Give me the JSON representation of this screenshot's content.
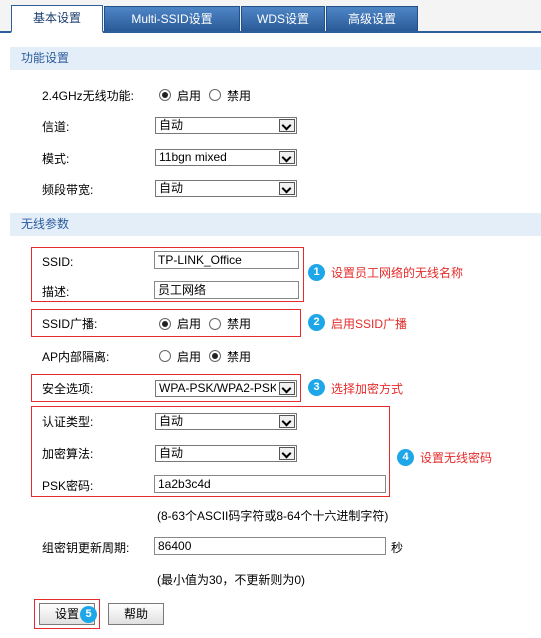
{
  "tabs": [
    "基本设置",
    "Multi-SSID设置",
    "WDS设置",
    "高级设置"
  ],
  "function_section": {
    "title": "功能设置",
    "wireless_label": "2.4GHz无线功能:",
    "enable": "启用",
    "disable": "禁用",
    "channel_label": "信道:",
    "channel_value": "自动",
    "mode_label": "模式:",
    "mode_value": "11bgn mixed",
    "bandwidth_label": "频段带宽:",
    "bandwidth_value": "自动"
  },
  "wireless_section": {
    "title": "无线参数",
    "ssid_label": "SSID:",
    "ssid_value": "TP-LINK_Office",
    "desc_label": "描述:",
    "desc_value": "员工网络",
    "broadcast_label": "SSID广播:",
    "isolation_label": "AP内部隔离:",
    "enable": "启用",
    "disable": "禁用",
    "security_label": "安全选项:",
    "security_value": "WPA-PSK/WPA2-PSK",
    "auth_label": "认证类型:",
    "auth_value": "自动",
    "encrypt_label": "加密算法:",
    "encrypt_value": "自动",
    "psk_label": "PSK密码:",
    "psk_value": "1a2b3c4d",
    "psk_hint": "(8-63个ASCII码字符或8-64个十六进制字符)",
    "renew_label": "组密钥更新周期:",
    "renew_value": "86400",
    "renew_unit": "秒",
    "renew_hint": "(最小值为30，不更新则为0)"
  },
  "annotations": [
    {
      "num": "1",
      "text": "设置员工网络的无线名称"
    },
    {
      "num": "2",
      "text": "启用SSID广播"
    },
    {
      "num": "3",
      "text": "选择加密方式"
    },
    {
      "num": "4",
      "text": "设置无线密码"
    },
    {
      "num": "5",
      "text": ""
    }
  ],
  "buttons": {
    "save": "设置",
    "help": "帮助"
  },
  "colors": {
    "tab_blue": "#2d5f9b",
    "section_bg": "#e4eef9",
    "highlight_red": "#e52b2b",
    "badge_blue": "#1ea7e8"
  }
}
